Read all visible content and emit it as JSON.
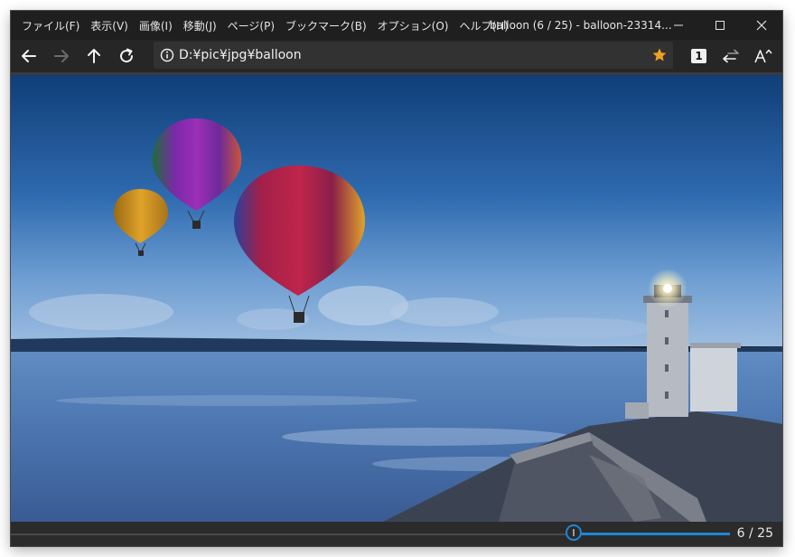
{
  "menu": [
    {
      "label": "ファイル(F)"
    },
    {
      "label": "表示(V)"
    },
    {
      "label": "画像(I)"
    },
    {
      "label": "移動(J)"
    },
    {
      "label": "ページ(P)"
    },
    {
      "label": "ブックマーク(B)"
    },
    {
      "label": "オプション(O)"
    },
    {
      "label": "ヘルプ(H)"
    }
  ],
  "window": {
    "title": "balloon (6 / 25) - balloon-23314..."
  },
  "toolbar": {
    "back_icon": "arrow-left-icon",
    "forward_icon": "arrow-right-icon",
    "up_icon": "arrow-up-icon",
    "reload_icon": "reload-icon",
    "page_badge": "1"
  },
  "address": {
    "path": "D:¥pic¥jpg¥balloon",
    "bookmark_color": "#f0a020"
  },
  "navigation": {
    "current_page": 6,
    "total_pages": 25,
    "counter_text": "6 / 25"
  },
  "colors": {
    "accent": "#1e88d8"
  }
}
